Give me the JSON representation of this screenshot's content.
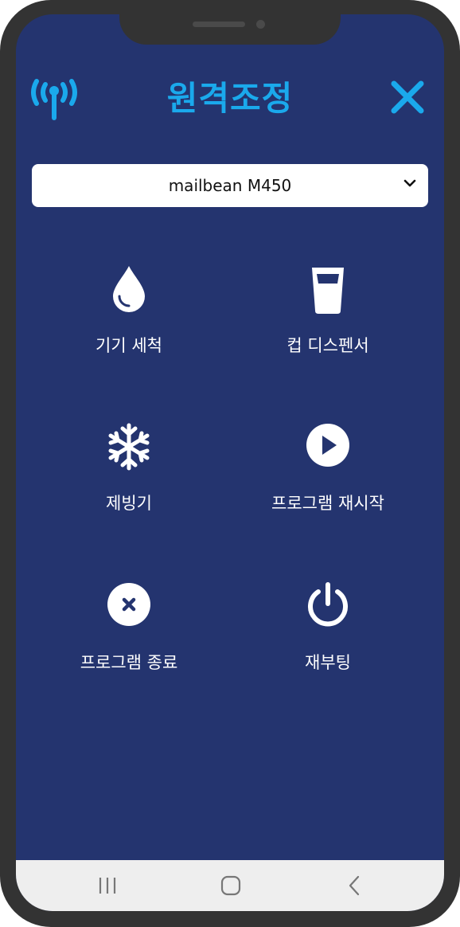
{
  "header": {
    "title": "원격조정",
    "signal_icon": "signal-antenna-icon",
    "close_icon": "close-icon"
  },
  "device_select": {
    "selected": "mailbean M450",
    "icon": "chevron-down-icon"
  },
  "actions": [
    {
      "label": "기기 세척",
      "icon": "water-drop-icon"
    },
    {
      "label": "컵 디스펜서",
      "icon": "cup-icon"
    },
    {
      "label": "제빙기",
      "icon": "snowflake-icon"
    },
    {
      "label": "프로그램 재시작",
      "icon": "play-circle-icon"
    },
    {
      "label": "프로그램 종료",
      "icon": "close-circle-icon"
    },
    {
      "label": "재부팅",
      "icon": "power-icon"
    }
  ],
  "navbar": {
    "recent": "recent-apps-icon",
    "home": "home-icon",
    "back": "back-icon"
  },
  "colors": {
    "background": "#24346f",
    "accent": "#1aa9ec",
    "icon": "#ffffff",
    "frame": "#333333"
  }
}
